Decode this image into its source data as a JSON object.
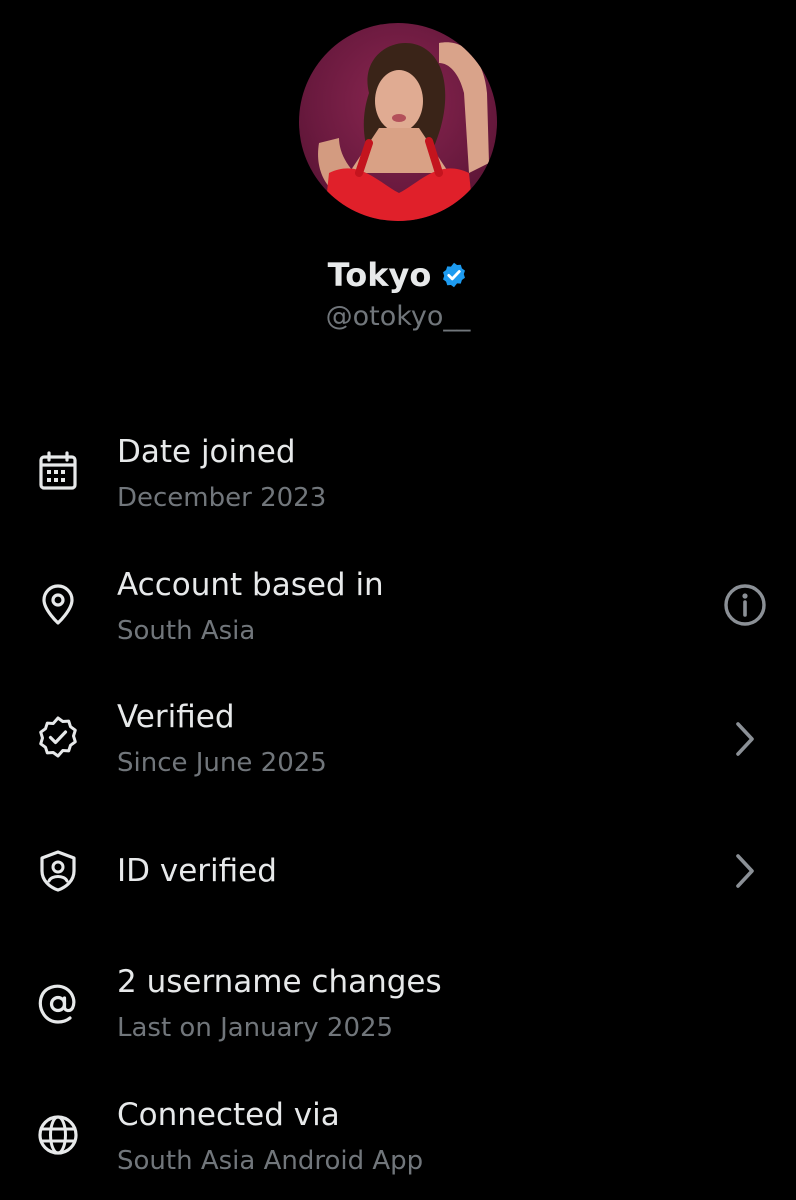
{
  "profile": {
    "display_name": "Tokyo",
    "handle": "@otokyo__",
    "verified": true,
    "avatar": "profile-photo"
  },
  "colors": {
    "background": "#000000",
    "primary_text": "#e7e9ea",
    "secondary_text": "#71767b",
    "verified_badge": "#1d9bf0"
  },
  "rows": [
    {
      "icon": "calendar-icon",
      "title": "Date joined",
      "subtitle": "December 2023"
    },
    {
      "icon": "location-pin-icon",
      "title": "Account based in",
      "subtitle": "South Asia",
      "trailing": "info-icon"
    },
    {
      "icon": "verified-badge-outline-icon",
      "title": "Verified",
      "subtitle": "Since June 2025",
      "trailing": "chevron-right-icon"
    },
    {
      "icon": "id-shield-icon",
      "title": "ID verified",
      "trailing": "chevron-right-icon"
    },
    {
      "icon": "at-sign-icon",
      "title": "2 username changes",
      "subtitle": "Last on January 2025"
    },
    {
      "icon": "globe-icon",
      "title": "Connected via",
      "subtitle": "South Asia Android App"
    }
  ]
}
